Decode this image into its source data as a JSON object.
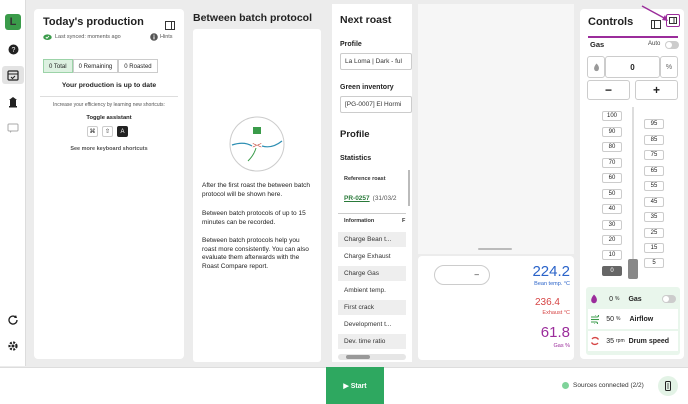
{
  "rail": {
    "logo": "L"
  },
  "production": {
    "title": "Today's production",
    "sync": "Last synced: moments ago",
    "hints": "Hints",
    "tabs": [
      "0 Total",
      "0 Remaining",
      "0 Roasted"
    ],
    "status": "Your production is up to date",
    "efficiency": "Increase your efficiency by learning new shortcuts:",
    "toggle_label": "Toggle assistant",
    "keys": [
      "⌘",
      "⇧",
      "A"
    ],
    "more_link": "See more keyboard shortcuts"
  },
  "between_batch": {
    "title": "Between batch protocol",
    "p1": "After the first roast the between batch protocol will be shown here.",
    "p2": "Between batch protocols of up to 15 minutes can be recorded.",
    "p3": "Between batch protocols help you roast more consistently. You can also evaluate them afterwards with the Roast Compare report."
  },
  "next_roast": {
    "title": "Next roast",
    "profile_label": "Profile",
    "profile_value": "La Loma | Dark - ful",
    "inventory_label": "Green inventory",
    "inventory_value": "[PG-0007] El Hormi",
    "profile_heading": "Profile",
    "statistics": "Statistics",
    "ref_header": "Reference roast",
    "ref_link": "PR-0257",
    "ref_date": "(31/03/2",
    "info_header": "Information",
    "info_col2": "F",
    "rows": [
      "Charge Bean t...",
      "Charge Exhaust",
      "Charge Gas",
      "Ambient temp.",
      "First crack",
      "Development t...",
      "Dev. time ratio"
    ]
  },
  "values": {
    "dropdown": "–",
    "bean_value": "224.2",
    "bean_label": "Bean temp. °C",
    "exhaust_value": "236.4",
    "exhaust_label": "Exhaust °C",
    "gas_value": "61.8",
    "gas_label": "Gas %",
    "colors": {
      "bean": "#2a63c9",
      "exhaust": "#d64545",
      "gas": "#9b2c9b"
    }
  },
  "controls": {
    "title": "Controls",
    "gas_label": "Gas",
    "auto_label": "Auto",
    "gas_input": "0",
    "gas_unit": "%",
    "minus": "−",
    "plus": "+",
    "scale_left": [
      "100",
      "90",
      "80",
      "70",
      "60",
      "50",
      "40",
      "30",
      "20",
      "10",
      "0"
    ],
    "scale_right": [
      "95",
      "85",
      "75",
      "65",
      "55",
      "45",
      "35",
      "25",
      "15",
      "5"
    ],
    "gas_row": {
      "value": "0",
      "unit": "%",
      "label": "Gas"
    },
    "airflow_row": {
      "value": "50",
      "unit": "%",
      "label": "Airflow"
    },
    "drum_row": {
      "value": "35",
      "unit": "rpm",
      "label": "Drum speed"
    },
    "accent": "#9b2c9b"
  },
  "bottom": {
    "start": "▶ Start",
    "sources": "Sources connected (2/2)"
  }
}
